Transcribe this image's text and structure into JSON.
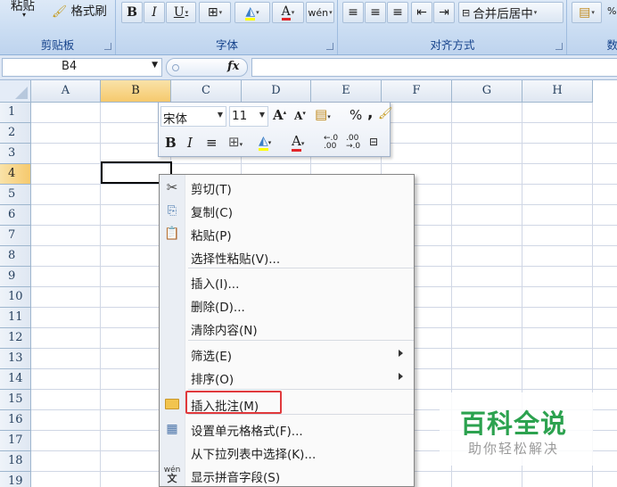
{
  "ribbon": {
    "paste_label": "粘贴",
    "format_painter_label": "格式刷",
    "groups": {
      "clipboard": "剪贴板",
      "font": "字体",
      "alignment": "对齐方式",
      "number_partial": "数"
    },
    "merge_center_label": "合并后居中"
  },
  "formula_bar": {
    "name_box_value": "B4",
    "fx_label": "fx",
    "formula_value": ""
  },
  "grid": {
    "columns": [
      "A",
      "B",
      "C",
      "D",
      "E",
      "F",
      "G",
      "H"
    ],
    "rows": [
      "1",
      "2",
      "3",
      "4",
      "5",
      "6",
      "7",
      "8",
      "9",
      "10",
      "11",
      "12",
      "13",
      "14",
      "15",
      "16",
      "17",
      "18",
      "19"
    ],
    "active_cell": "B4"
  },
  "mini_toolbar": {
    "font_name": "宋体",
    "font_size": "11",
    "percent": "%",
    "comma": ",",
    "bold": "B",
    "italic": "I",
    "font_color_letter": "A",
    "increase_decimal": "+.0\n.00",
    "decrease_decimal": ".00\n+.0"
  },
  "context_menu": {
    "items": [
      {
        "label": "剪切(T)",
        "icon": "scissors-icon"
      },
      {
        "label": "复制(C)",
        "icon": "copy-icon"
      },
      {
        "label": "粘贴(P)",
        "icon": "paste-icon"
      },
      {
        "label": "选择性粘贴(V)...",
        "icon": ""
      },
      {
        "label": "插入(I)...",
        "icon": ""
      },
      {
        "label": "删除(D)...",
        "icon": ""
      },
      {
        "label": "清除内容(N)",
        "icon": ""
      },
      {
        "label": "筛选(E)",
        "icon": "",
        "submenu": true
      },
      {
        "label": "排序(O)",
        "icon": "",
        "submenu": true
      },
      {
        "label": "插入批注(M)",
        "icon": "folder-icon",
        "highlighted": true
      },
      {
        "label": "设置单元格格式(F)...",
        "icon": "format-cells-icon"
      },
      {
        "label": "从下拉列表中选择(K)...",
        "icon": ""
      },
      {
        "label": "显示拼音字段(S)",
        "icon": "phonetic-icon"
      }
    ],
    "highlight_color": "#e0393c"
  },
  "watermark": {
    "title": "百科全说",
    "subtitle": "助你轻松解决",
    "color": "#2ca24f"
  }
}
